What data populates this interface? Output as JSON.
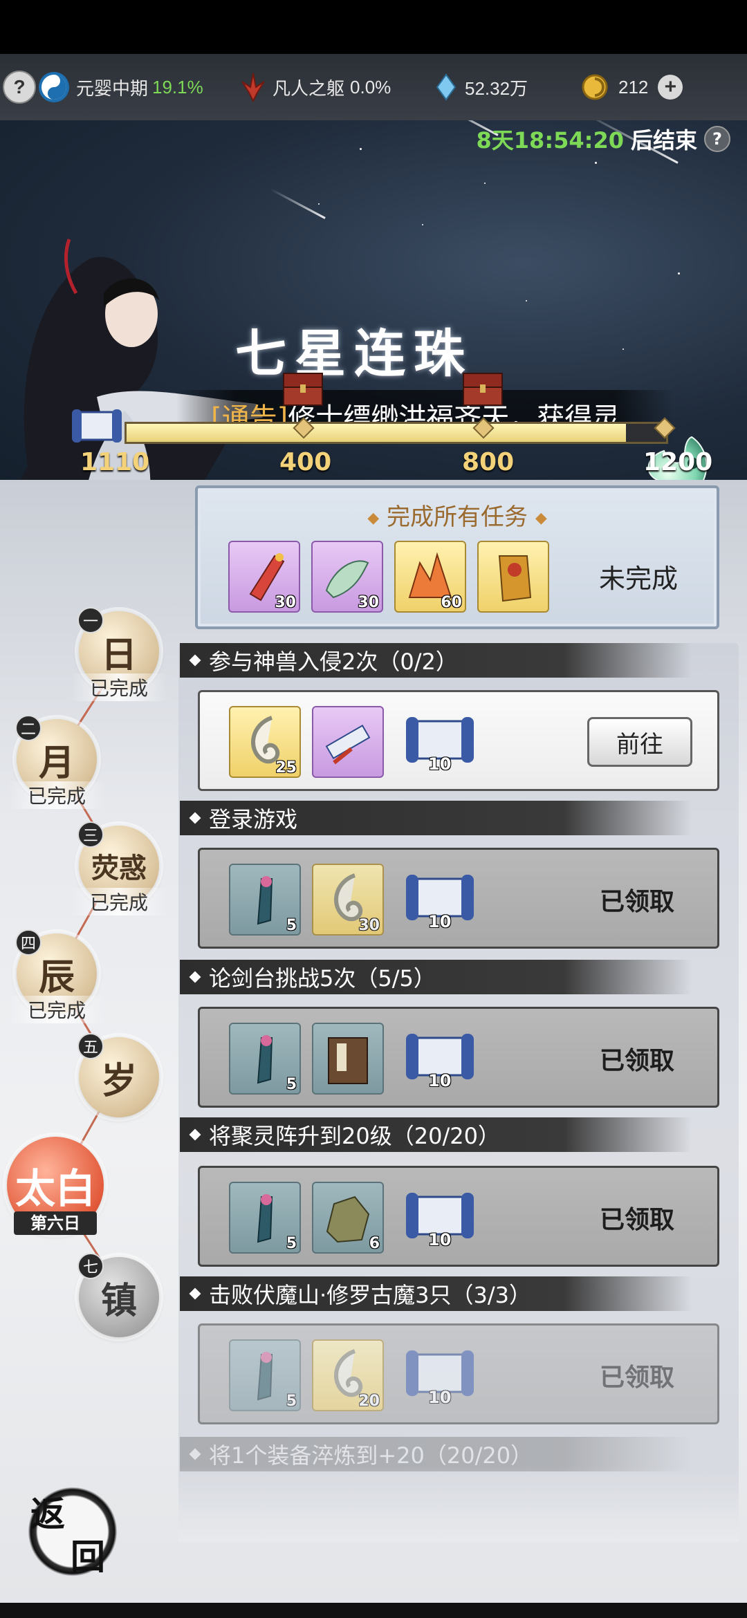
{
  "resources": {
    "cultivation_label": "元婴中期",
    "cultivation_pct": "19.1%",
    "body_label": "凡人之躯",
    "body_pct": "0.0%",
    "spirit_stones": "52.32万",
    "currency": "212"
  },
  "event": {
    "countdown_time": "8天18:54:20",
    "countdown_suffix": "后结束",
    "title": "七星连珠",
    "notice_tag": "[通告]",
    "notice_text": "修士缥缈洪福齐天，获得灵"
  },
  "progress": {
    "current": "1110",
    "milestones": [
      "400",
      "800",
      "1200"
    ],
    "fraction": 0.925
  },
  "all_tasks": {
    "title": "完成所有任务",
    "status": "未完成",
    "rewards": [
      "30",
      "30",
      "60",
      ""
    ]
  },
  "days": [
    {
      "num": "一",
      "glyph": "日",
      "status": "已完成"
    },
    {
      "num": "二",
      "glyph": "月",
      "status": "已完成"
    },
    {
      "num": "三",
      "glyph": "荧惑",
      "status": "已完成"
    },
    {
      "num": "四",
      "glyph": "辰",
      "status": "已完成"
    },
    {
      "num": "五",
      "glyph": "岁",
      "status": ""
    },
    {
      "num": "",
      "glyph": "太白",
      "status": "第六日"
    },
    {
      "num": "七",
      "glyph": "镇",
      "status": ""
    }
  ],
  "tasks": [
    {
      "title": "参与神兽入侵2次（0/2）",
      "rewards": [
        "25",
        "",
        "10"
      ],
      "action": "前往"
    },
    {
      "title": "登录游戏",
      "rewards": [
        "5",
        "30",
        "10"
      ],
      "action": "已领取"
    },
    {
      "title": "论剑台挑战5次（5/5）",
      "rewards": [
        "5",
        "",
        "10"
      ],
      "action": "已领取"
    },
    {
      "title": "将聚灵阵升到20级（20/20）",
      "rewards": [
        "5",
        "6",
        "10"
      ],
      "action": "已领取"
    },
    {
      "title": "击败伏魔山·修罗古魔3只（3/3）",
      "rewards": [
        "5",
        "20",
        "10"
      ],
      "action": "已领取"
    },
    {
      "title": "将1个装备淬炼到+20（20/20）"
    }
  ],
  "back_button": {
    "char1": "返",
    "char2": "回"
  },
  "colors": {
    "accent_green": "#7ed957",
    "gold_number": "#f3d27a",
    "notice_tag": "#f0b54a"
  }
}
